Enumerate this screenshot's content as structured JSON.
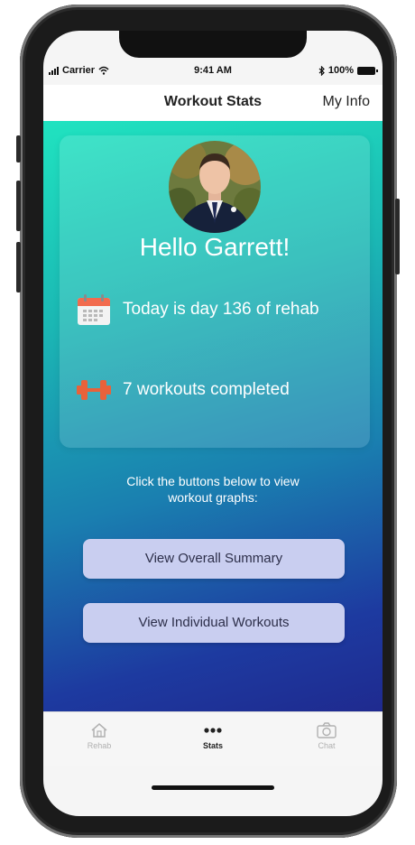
{
  "status_bar": {
    "carrier": "Carrier",
    "time": "9:41 AM",
    "battery": "100%"
  },
  "navbar": {
    "title": "Workout Stats",
    "right_action": "My Info"
  },
  "card": {
    "greeting": "Hello Garrett!",
    "day_text": "Today is day 136 of rehab",
    "workouts_text": "7 workouts completed"
  },
  "instructions": {
    "line1": "Click the buttons below to view",
    "line2": "workout graphs:"
  },
  "buttons": {
    "overall": "View Overall Summary",
    "individual": "View Individual Workouts"
  },
  "tabbar": {
    "tabs": [
      {
        "label": "Rehab",
        "icon": "home-icon"
      },
      {
        "label": "Stats",
        "icon": "more-dots-icon"
      },
      {
        "label": "Chat",
        "icon": "camera-icon"
      }
    ],
    "active": "Stats"
  },
  "colors": {
    "gradient_top": "#20e3c0",
    "gradient_bottom": "#1f2a8f",
    "button_bg": "#c9cef0",
    "dumbbell": "#e8623a",
    "calendar_top": "#f26b4e"
  }
}
